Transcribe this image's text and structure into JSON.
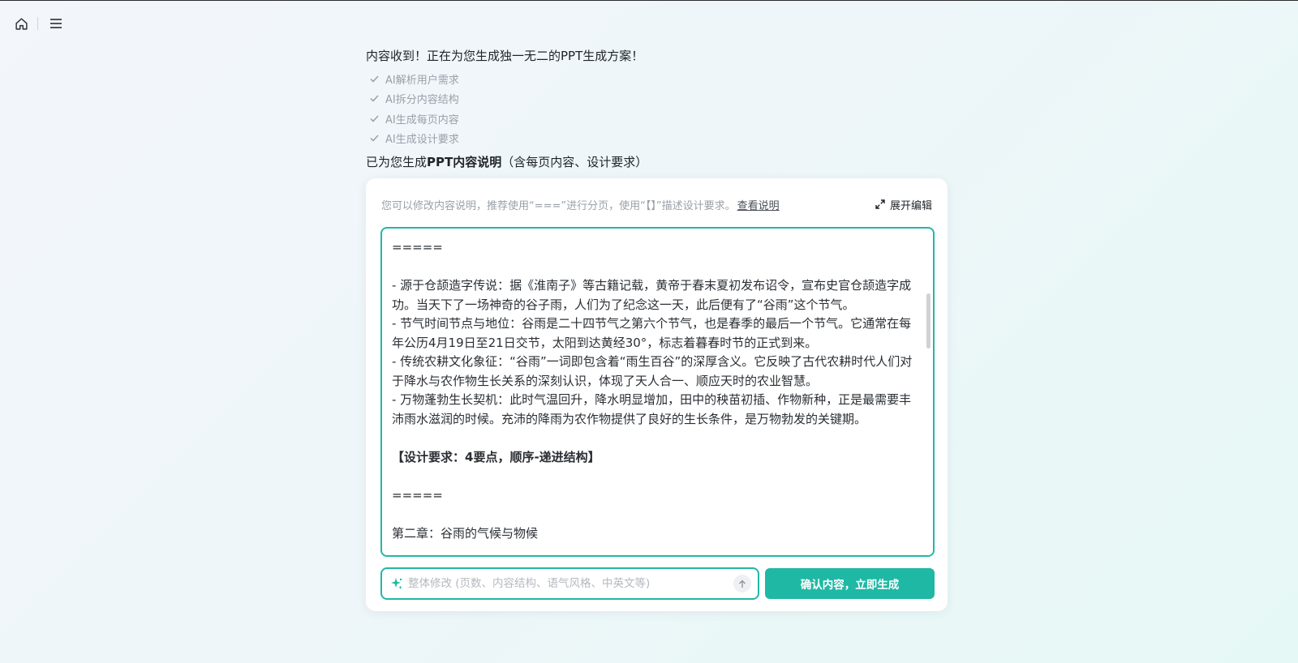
{
  "message": "内容收到！正在为您生成独一无二的PPT生成方案！",
  "steps": [
    "AI解析用户需求",
    "AI拆分内容结构",
    "AI生成每页内容",
    "AI生成设计要求"
  ],
  "generated": {
    "prefix": "已为您生成",
    "bold": "PPT内容说明",
    "suffix": "（含每页内容、设计要求）"
  },
  "card": {
    "hint": "您可以修改内容说明，推荐使用“===”进行分页，使用“【】”描述设计要求。",
    "hint_link": "查看说明",
    "expand_label": "展开编辑"
  },
  "editor": {
    "lines": [
      {
        "text": "=====",
        "bold": false
      },
      {
        "text": "",
        "bold": false
      },
      {
        "text": "- 源于仓颉造字传说：据《淮南子》等古籍记载，黄帝于春末夏初发布诏令，宣布史官仓颉造字成功。当天下了一场神奇的谷子雨，人们为了纪念这一天，此后便有了“谷雨”这个节气。",
        "bold": false
      },
      {
        "text": "- 节气时间节点与地位：谷雨是二十四节气之第六个节气，也是春季的最后一个节气。它通常在每年公历4月19日至21日交节，太阳到达黄经30°，标志着暮春时节的正式到来。",
        "bold": false
      },
      {
        "text": "- 传统农耕文化象征：“谷雨”一词即包含着“雨生百谷”的深厚含义。它反映了古代农耕时代人们对于降水与农作物生长关系的深刻认识，体现了天人合一、顺应天时的农业智慧。",
        "bold": false
      },
      {
        "text": "- 万物蓬勃生长契机：此时气温回升，降水明显增加，田中的秧苗初插、作物新种，正是最需要丰沛雨水滋润的时候。充沛的降雨为农作物提供了良好的生长条件，是万物勃发的关键期。",
        "bold": false
      },
      {
        "text": "",
        "bold": false
      },
      {
        "text": "【设计要求：4要点，顺序-递进结构】",
        "bold": true
      },
      {
        "text": "",
        "bold": false
      },
      {
        "text": "=====",
        "bold": false
      },
      {
        "text": "",
        "bold": false
      },
      {
        "text": "第二章：谷雨的气候与物候",
        "bold": false
      }
    ]
  },
  "input": {
    "placeholder": "整体修改 (页数、内容结构、语气风格、中英文等)"
  },
  "confirm_label": "确认内容，立即生成",
  "colors": {
    "accent": "#1fb8a4"
  }
}
